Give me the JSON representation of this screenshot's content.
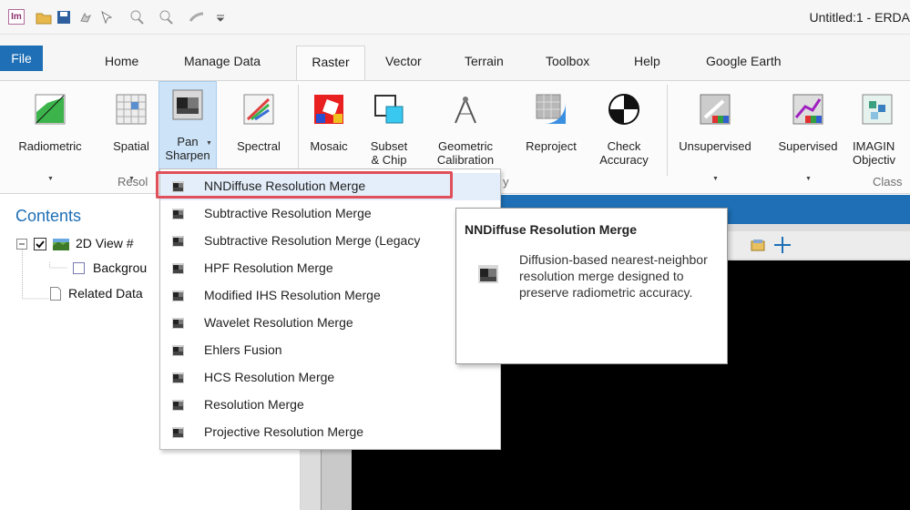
{
  "window": {
    "title": "Untitled:1 - ERDA"
  },
  "tabs": [
    "File",
    "Home",
    "Manage Data",
    "Raster",
    "Vector",
    "Terrain",
    "Toolbox",
    "Help",
    "Google Earth"
  ],
  "ribbon": {
    "buttons": [
      {
        "label": "Radiometric",
        "dropdown": true
      },
      {
        "label": "Spatial",
        "dropdown": true
      },
      {
        "label": "Pan\nSharpen",
        "dropdown": true
      },
      {
        "label": "Spectral",
        "dropdown": true
      },
      {
        "label": "Mosaic",
        "dropdown": true
      },
      {
        "label": "Subset\n& Chip",
        "dropdown": true
      },
      {
        "label": "Geometric\nCalibration",
        "dropdown": true
      },
      {
        "label": "Reproject",
        "dropdown": false
      },
      {
        "label": "Check\nAccuracy",
        "dropdown": false
      },
      {
        "label": "Unsupervised",
        "dropdown": true
      },
      {
        "label": "Supervised",
        "dropdown": true
      },
      {
        "label": "IMAGIN\nObjectiv",
        "dropdown": false
      }
    ],
    "groups": [
      "Resol",
      "y",
      "Class"
    ]
  },
  "contents": {
    "title": "Contents",
    "tree": [
      "2D View #",
      "Backgrou",
      "Related Data"
    ]
  },
  "menu": {
    "items": [
      "NNDiffuse Resolution Merge",
      "Subtractive Resolution Merge",
      "Subtractive Resolution Merge (Legacy",
      "HPF Resolution Merge",
      "Modified IHS Resolution Merge",
      "Wavelet Resolution Merge",
      "Ehlers Fusion",
      "HCS Resolution Merge",
      "Resolution Merge",
      "Projective Resolution Merge"
    ],
    "highlighted_index": 0
  },
  "tooltip": {
    "title": "NNDiffuse Resolution Merge",
    "body": "Diffusion-based nearest-neighbor resolution merge designed to preserve radiometric accuracy."
  },
  "colors": {
    "accent": "#1e6fb5",
    "highlight_border": "#e0505a",
    "menu_hover": "#e3eefa"
  }
}
